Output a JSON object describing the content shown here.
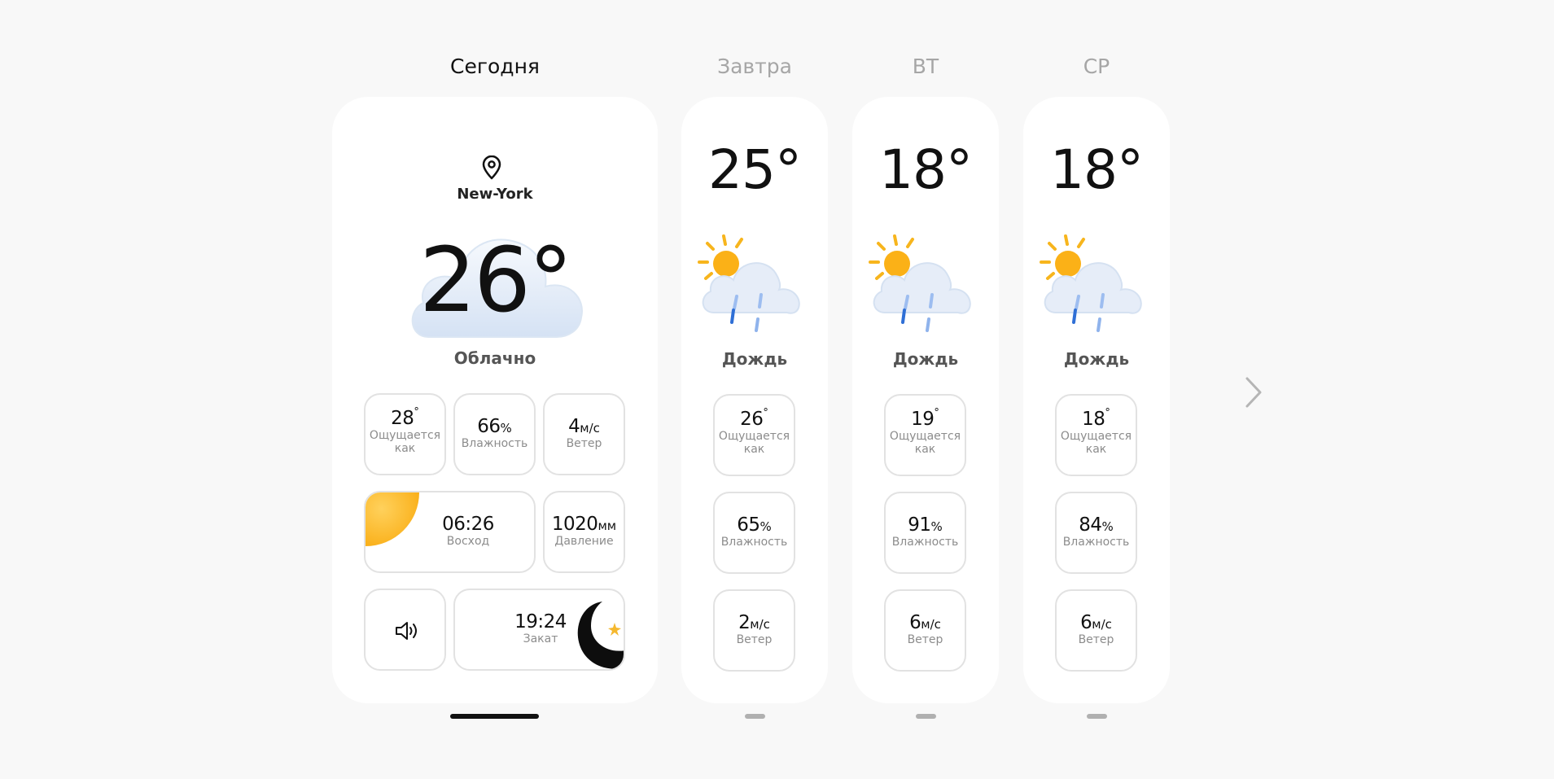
{
  "today": {
    "tab": "Сегодня",
    "location": "New-York",
    "temp": "26°",
    "condition": "Облачно",
    "feels": {
      "value": "28",
      "deg": "°",
      "label": "Ощущается\nкак"
    },
    "humidity": {
      "value": "66",
      "unit": "%",
      "label": "Влажность"
    },
    "wind": {
      "value": "4",
      "unit": "м/с",
      "label": "Ветер"
    },
    "sunrise": {
      "time": "06:26",
      "label": "Восход"
    },
    "pressure": {
      "value": "1020",
      "unit": "мм",
      "label": "Давление"
    },
    "sunset": {
      "time": "19:24",
      "label": "Закат"
    }
  },
  "days": [
    {
      "tab": "Завтра",
      "temp": "25°",
      "condition": "Дождь",
      "feels": {
        "value": "26",
        "deg": "°",
        "label": "Ощущается\nкак"
      },
      "humidity": {
        "value": "65",
        "unit": "%",
        "label": "Влажность"
      },
      "wind": {
        "value": "2",
        "unit": "м/с",
        "label": "Ветер"
      }
    },
    {
      "tab": "ВТ",
      "temp": "18°",
      "condition": "Дождь",
      "feels": {
        "value": "19",
        "deg": "°",
        "label": "Ощущается\nкак"
      },
      "humidity": {
        "value": "91",
        "unit": "%",
        "label": "Влажность"
      },
      "wind": {
        "value": "6",
        "unit": "м/с",
        "label": "Ветер"
      }
    },
    {
      "tab": "СР",
      "temp": "18°",
      "condition": "Дождь",
      "feels": {
        "value": "18",
        "deg": "°",
        "label": "Ощущается\nкак"
      },
      "humidity": {
        "value": "84",
        "unit": "%",
        "label": "Влажность"
      },
      "wind": {
        "value": "6",
        "unit": "м/с",
        "label": "Ветер"
      }
    }
  ],
  "colors": {
    "accent": "#111111",
    "muted": "#a6a6a6",
    "sun": "#fbb117",
    "rain": "#2f6fd6",
    "cloud": "#e3ecf8"
  },
  "icons": {
    "location": "location-pin-icon",
    "sound": "speaker-icon",
    "next": "chevron-right-icon"
  }
}
